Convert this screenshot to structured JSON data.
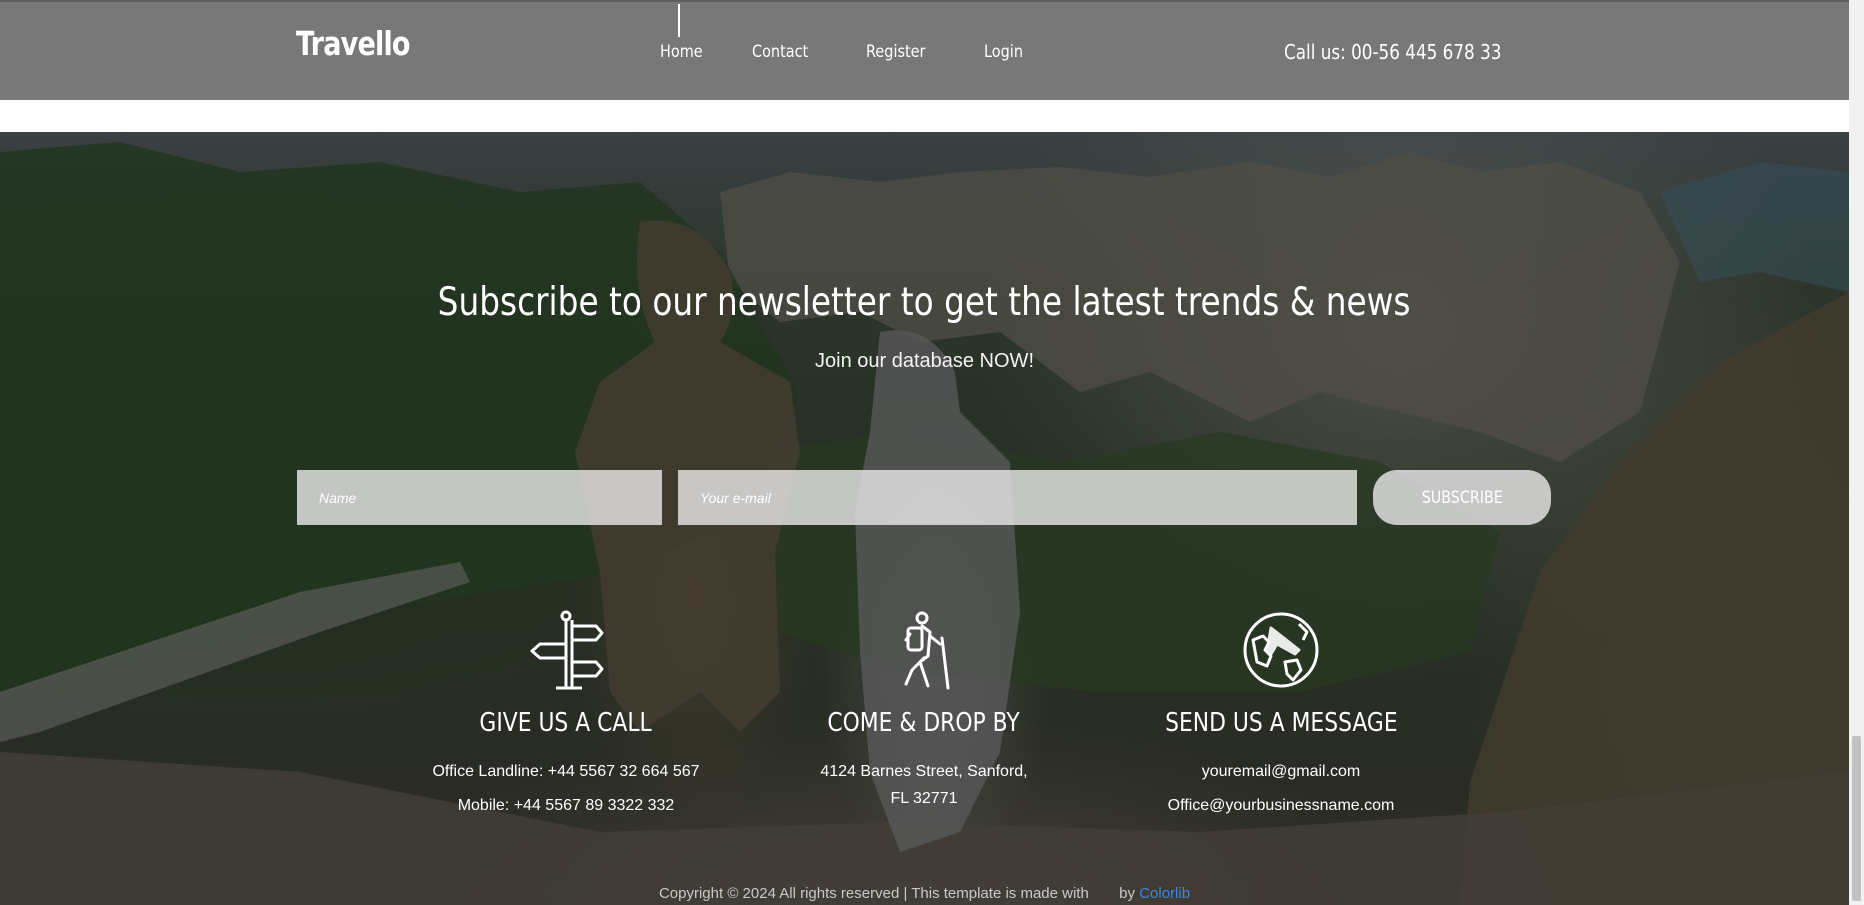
{
  "header": {
    "logo": "Travello",
    "nav": [
      {
        "label": "Home",
        "active": true
      },
      {
        "label": "Contact"
      },
      {
        "label": "Register"
      },
      {
        "label": "Login"
      }
    ],
    "call": "Call us: 00-56 445 678 33"
  },
  "newsletter": {
    "headline": "Subscribe to our newsletter to get the latest trends & news",
    "subhead": "Join our database NOW!",
    "name_placeholder": "Name",
    "email_placeholder": "Your e-mail",
    "button_label": "SUBSCRIBE"
  },
  "contacts": [
    {
      "icon": "signpost-icon",
      "title": "GIVE US A CALL",
      "lines": [
        "Office Landline: +44 5567 32 664 567",
        "Mobile: +44 5567 89 3322 332"
      ]
    },
    {
      "icon": "hiker-icon",
      "title": "COME & DROP BY",
      "lines": [
        "4124 Barnes Street, Sanford,",
        "FL 32771"
      ]
    },
    {
      "icon": "globe-plane-icon",
      "title": "SEND US A MESSAGE",
      "lines": [
        "youremail@gmail.com",
        "Office@yourbusinessname.com"
      ]
    }
  ],
  "footer": {
    "copyright": "Copyright © 2024 All rights reserved | This template is made with",
    "by": "by",
    "link": "Colorlib"
  },
  "colors": {
    "header_bg": "#787878",
    "link": "#3b86d8"
  }
}
